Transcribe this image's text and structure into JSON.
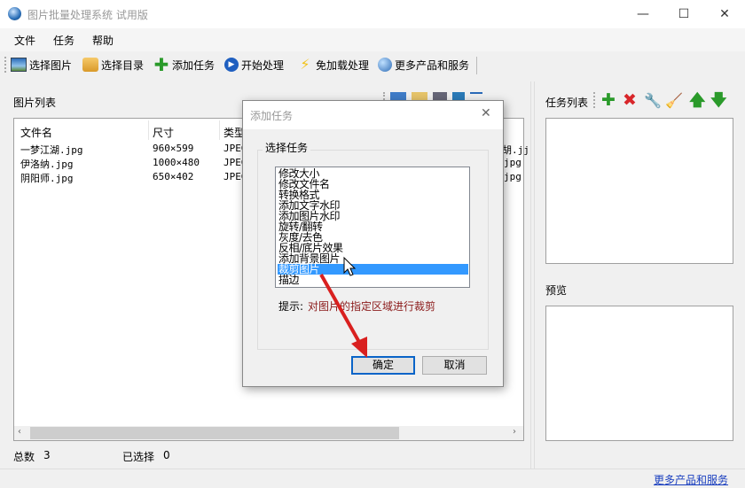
{
  "window": {
    "title": "图片批量处理系统 试用版",
    "minimize": "—",
    "maximize": "☐",
    "close": "✕"
  },
  "menu": [
    "文件",
    "任务",
    "帮助"
  ],
  "toolbar": [
    {
      "label": "选择图片",
      "icon": "image-icon"
    },
    {
      "label": "选择目录",
      "icon": "folder-icon"
    },
    {
      "label": "添加任务",
      "icon": "plus-icon"
    },
    {
      "label": "开始处理",
      "icon": "play-icon"
    },
    {
      "label": "免加载处理",
      "icon": "lightning-icon"
    },
    {
      "label": "更多产品和服务",
      "icon": "globe-icon"
    }
  ],
  "image_list": {
    "title": "图片列表",
    "columns": [
      "文件名",
      "尺寸",
      "类型"
    ],
    "rows": [
      {
        "name": "一梦江湖.jpg",
        "size": "960×599",
        "type": "JPEG",
        "tail": "胡.jj"
      },
      {
        "name": "伊洛纳.jpg",
        "size": "1000×480",
        "type": "JPEG",
        "tail": "jpg"
      },
      {
        "name": "阴阳师.jpg",
        "size": "650×402",
        "type": "JPEG",
        "tail": "jpg"
      }
    ]
  },
  "status": {
    "total_label": "总数",
    "total": "3",
    "selected_label": "已选择",
    "selected": "0"
  },
  "task_list": {
    "title": "任务列表"
  },
  "preview": {
    "title": "预览"
  },
  "footer_link": "更多产品和服务",
  "dialog": {
    "title": "添加任务",
    "group": "选择任务",
    "items": [
      "修改大小",
      "修改文件名",
      "转换格式",
      "添加文字水印",
      "添加图片水印",
      "旋转/翻转",
      "灰度/去色",
      "反相/底片效果",
      "添加背景图片",
      "裁剪图片",
      "描边"
    ],
    "selected_index": 9,
    "hint_label": "提示:",
    "hint": "对图片的指定区域进行裁剪",
    "ok": "确定",
    "cancel": "取消",
    "close": "✕"
  },
  "colors": {
    "selection": "#3399ff",
    "hint": "#8b1a1a",
    "link": "#1a3fbf",
    "annotation_arrow": "#d9201f"
  }
}
